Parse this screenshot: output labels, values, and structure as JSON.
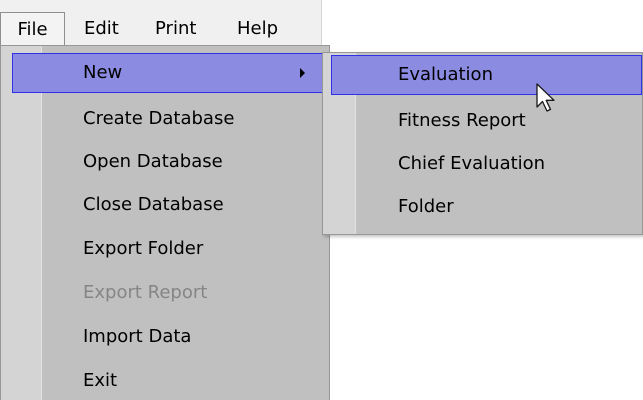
{
  "menubar": {
    "items": [
      {
        "label": "File"
      },
      {
        "label": "Edit"
      },
      {
        "label": "Print"
      },
      {
        "label": "Help"
      }
    ]
  },
  "file_menu": {
    "items": [
      {
        "label": "New",
        "has_submenu": true,
        "highlighted": true
      },
      {
        "label": "Create Database"
      },
      {
        "label": "Open Database"
      },
      {
        "label": "Close Database"
      },
      {
        "label": "Export Folder"
      },
      {
        "label": "Export Report",
        "disabled": true
      },
      {
        "label": "Import Data"
      },
      {
        "label": "Exit"
      }
    ]
  },
  "new_submenu": {
    "items": [
      {
        "label": "Evaluation",
        "highlighted": true
      },
      {
        "label": "Fitness Report"
      },
      {
        "label": "Chief Evaluation"
      },
      {
        "label": "Folder"
      }
    ]
  },
  "colors": {
    "highlight_fill": "#8a8be1",
    "highlight_border": "#2e31e8",
    "menu_bg": "#c0c0c0",
    "disabled_text": "#858585"
  },
  "icons": {
    "submenu_indicator": "chevron-right-icon",
    "pointer": "mouse-pointer-icon"
  }
}
